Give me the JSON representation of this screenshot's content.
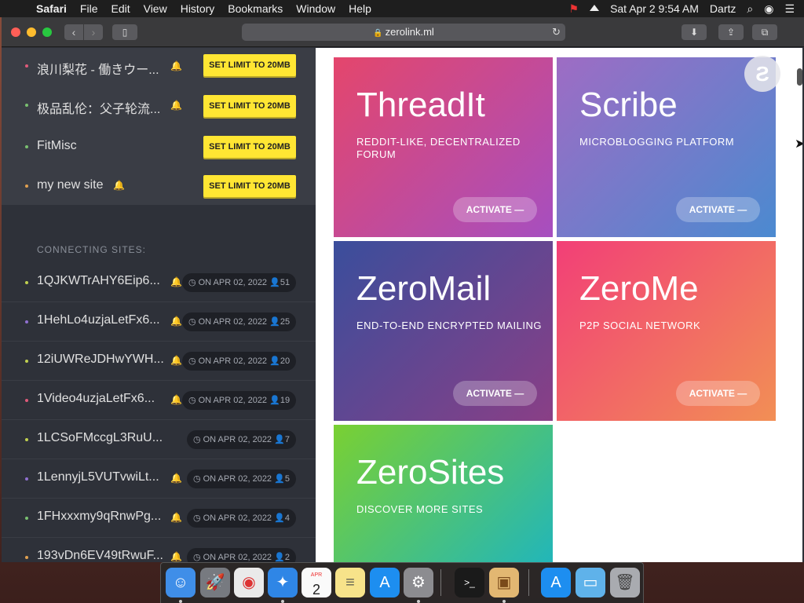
{
  "menubar": {
    "app": "Safari",
    "items": [
      "File",
      "Edit",
      "View",
      "History",
      "Bookmarks",
      "Window",
      "Help"
    ],
    "clock": "Sat Apr 2  9:54 AM",
    "user": "Dartz"
  },
  "browser": {
    "url": "zerolink.ml"
  },
  "sidebar": {
    "my_sites": [
      {
        "name": "浪川梨花 - 働きウー...",
        "color": "#e05a7a",
        "bell": true,
        "button": "SET LIMIT TO 20MB"
      },
      {
        "name": "极品乱伦：父子轮流...",
        "color": "#7ac070",
        "bell": true,
        "button": "SET LIMIT TO 20MB"
      },
      {
        "name": "FitMisc",
        "color": "#7ac070",
        "bell": false,
        "button": "SET LIMIT TO 20MB"
      },
      {
        "name": "my new site",
        "color": "#e0a050",
        "bell": true,
        "button": "SET LIMIT TO 20MB"
      }
    ],
    "connecting_header": "CONNECTING SITES:",
    "connecting": [
      {
        "name": "1QJKWTrAHY6Eip6...",
        "color": "#c0d050",
        "bell": true,
        "date": "ON APR 02, 2022",
        "peers": "51"
      },
      {
        "name": "1HehLo4uzjaLetFx6...",
        "color": "#9070d0",
        "bell": true,
        "date": "ON APR 02, 2022",
        "peers": "25"
      },
      {
        "name": "12iUWReJDHwYWH...",
        "color": "#c0d050",
        "bell": true,
        "date": "ON APR 02, 2022",
        "peers": "20"
      },
      {
        "name": "1Video4uzjaLetFx6...",
        "color": "#e05a7a",
        "bell": true,
        "date": "ON APR 02, 2022",
        "peers": "19"
      },
      {
        "name": "1LCSoFMccgL3RuU...",
        "color": "#c0d050",
        "bell": false,
        "date": "ON APR 02, 2022",
        "peers": "7"
      },
      {
        "name": "1LennyjL5VUTvwiLt...",
        "color": "#9070d0",
        "bell": true,
        "date": "ON APR 02, 2022",
        "peers": "5"
      },
      {
        "name": "1FHxxxmy9qRnwPg...",
        "color": "#7ac070",
        "bell": true,
        "date": "ON APR 02, 2022",
        "peers": "4"
      },
      {
        "name": "193vDn6EV49tRwuF...",
        "color": "#e0a050",
        "bell": true,
        "date": "ON APR 02, 2022",
        "peers": "2"
      }
    ]
  },
  "apps": [
    {
      "title": "ThreadIt",
      "subtitle": "REDDIT-LIKE, DECENTRALIZED FORUM",
      "action": "ACTIVATE —"
    },
    {
      "title": "Scribe",
      "subtitle": "MICROBLOGGING PLATFORM",
      "action": "ACTIVATE —"
    },
    {
      "title": "ZeroMail",
      "subtitle": "END-TO-END ENCRYPTED MAILING",
      "action": "ACTIVATE —"
    },
    {
      "title": "ZeroMe",
      "subtitle": "P2P SOCIAL NETWORK",
      "action": "ACTIVATE —"
    },
    {
      "title": "ZeroSites",
      "subtitle": "DISCOVER MORE SITES"
    }
  ],
  "dock": {
    "calendar_month": "APR",
    "calendar_day": "2",
    "icons": [
      "finder-icon",
      "launchpad-icon",
      "chrome-icon",
      "safari-icon",
      "calendar-icon",
      "notes-icon",
      "app-store-icon",
      "system-preferences-icon",
      "terminal-icon",
      "installer-icon",
      "app-store-downloads-icon",
      "folder-icon",
      "trash-icon"
    ]
  }
}
